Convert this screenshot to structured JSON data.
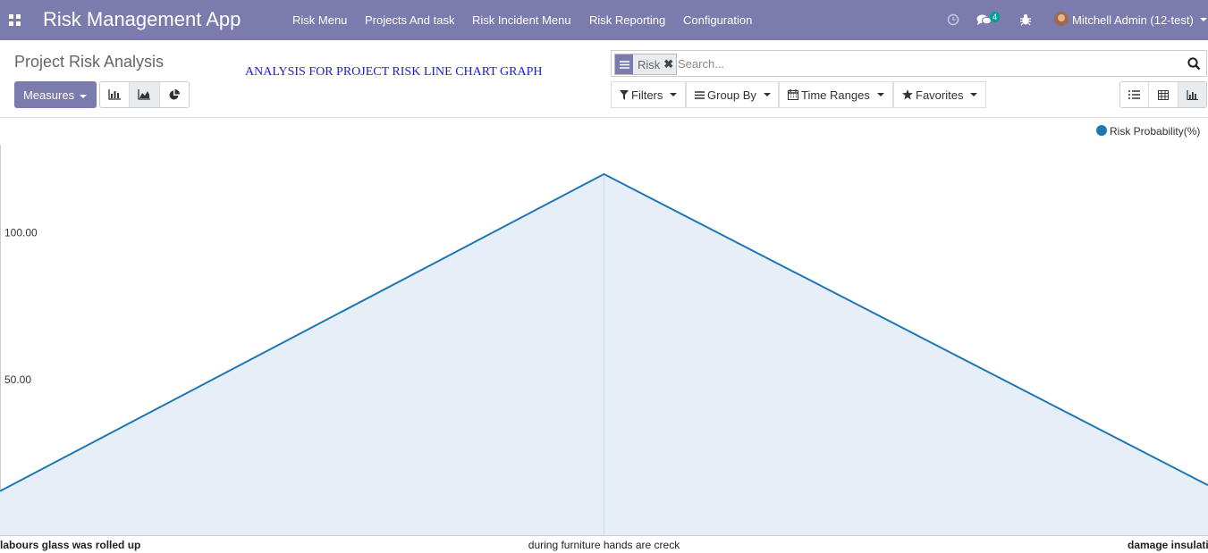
{
  "app": {
    "brand": "Risk Management App",
    "menu": [
      "Risk Menu",
      "Projects And task",
      "Risk Incident Menu",
      "Risk Reporting",
      "Configuration"
    ],
    "message_count": "4",
    "user": "Mitchell Admin (12-test)"
  },
  "control_panel": {
    "title": "Project Risk Analysis",
    "annotation": "ANALYSIS FOR PROJECT RISK LINE CHART GRAPH",
    "measures_label": "Measures",
    "search": {
      "facet_label": "Risk",
      "placeholder": "Search..."
    },
    "filters_label": "Filters",
    "groupby_label": "Group By",
    "timeranges_label": "Time Ranges",
    "favorites_label": "Favorites"
  },
  "colors": {
    "navbar": "#7c7bad",
    "series": "#1f77b4",
    "area_fill": "#e6eff8"
  },
  "chart_data": {
    "type": "area",
    "categories": [
      "labours glass was rolled up",
      "during furniture hands are creck",
      "damage insulati"
    ],
    "series": [
      {
        "name": "Risk Probability(%)",
        "values": [
          12,
          120,
          14
        ]
      }
    ],
    "y_ticks": [
      "50.00",
      "100.00"
    ],
    "ylim": [
      -3,
      130
    ],
    "legend": "top-right",
    "grid": false
  }
}
